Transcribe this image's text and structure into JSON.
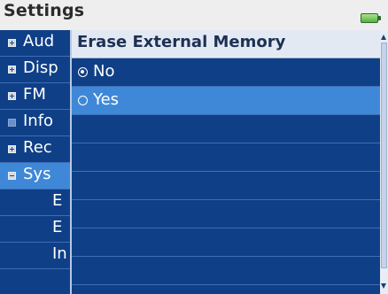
{
  "header": {
    "title": "Settings",
    "battery_icon": "battery-icon"
  },
  "list": {
    "items": [
      {
        "label": "Aud",
        "icon": "plus-square-icon"
      },
      {
        "label": "Disp",
        "icon": "plus-square-icon"
      },
      {
        "label": "FM",
        "icon": "plus-square-icon"
      },
      {
        "label": "Info",
        "icon": "square-icon"
      },
      {
        "label": "Rec",
        "icon": "plus-square-icon"
      },
      {
        "label": "Sys",
        "icon": "minus-square-icon",
        "selected": true
      },
      {
        "label": "E"
      },
      {
        "label": "E"
      },
      {
        "label": "In"
      }
    ]
  },
  "dialog": {
    "title": "Erase External Memory",
    "options": [
      {
        "label": "No",
        "checked": true
      },
      {
        "label": "Yes",
        "selected": true
      }
    ]
  },
  "colors": {
    "list_bg": "#0f3f87",
    "highlight": "#3f88d8",
    "header_bg": "#eeeeee",
    "dialog_header_bg": "#e3e9f3"
  }
}
